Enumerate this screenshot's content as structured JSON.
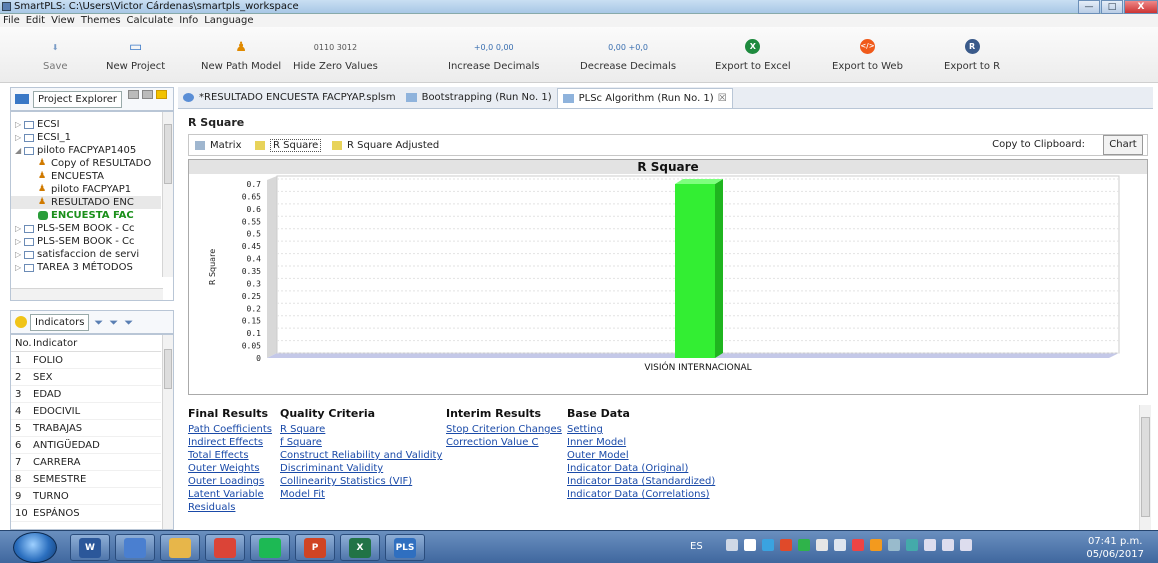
{
  "window": {
    "title": "SmartPLS: C:\\Users\\Victor Cárdenas\\smartpls_workspace",
    "minimize": "—",
    "maximize": "□",
    "close": "X"
  },
  "menu": [
    "File",
    "Edit",
    "View",
    "Themes",
    "Calculate",
    "Info",
    "Language"
  ],
  "toolbar": [
    {
      "label": "Save",
      "icon": "save-icon",
      "glyph": "⬇"
    },
    {
      "label": "New Project",
      "icon": "new-project-icon",
      "glyph": "▭"
    },
    {
      "label": "New Path Model",
      "icon": "new-path-model-icon",
      "glyph": "♟"
    },
    {
      "label": "Hide Zero Values",
      "icon": "hide-zero-values-icon",
      "glyph": "0110 3012"
    },
    {
      "label": "Increase Decimals",
      "icon": "increase-decimals-icon",
      "glyph": "+0,0 0,00"
    },
    {
      "label": "Decrease Decimals",
      "icon": "decrease-decimals-icon",
      "glyph": "0,00 +0,0"
    },
    {
      "label": "Export to Excel",
      "icon": "excel-icon",
      "glyph": "X"
    },
    {
      "label": "Export to Web",
      "icon": "web-icon",
      "glyph": "</>"
    },
    {
      "label": "Export to R",
      "icon": "r-icon",
      "glyph": "R"
    }
  ],
  "project_explorer": {
    "title": "Project Explorer",
    "items": [
      {
        "label": "ECSI",
        "type": "folder",
        "indent": 0,
        "toggle": "▷"
      },
      {
        "label": "ECSI_1",
        "type": "folder",
        "indent": 0,
        "toggle": "▷"
      },
      {
        "label": "piloto FACPYAP1405",
        "type": "folder",
        "indent": 0,
        "toggle": "◢"
      },
      {
        "label": "Copy of RESULTADO",
        "type": "model",
        "indent": 1,
        "toggle": ""
      },
      {
        "label": "ENCUESTA",
        "type": "model",
        "indent": 1,
        "toggle": ""
      },
      {
        "label": "piloto FACPYAP1",
        "type": "model",
        "indent": 1,
        "toggle": ""
      },
      {
        "label": "RESULTADO ENC",
        "type": "model",
        "indent": 1,
        "toggle": "",
        "selected": true
      },
      {
        "label": "ENCUESTA FAC",
        "type": "data",
        "indent": 1,
        "toggle": "",
        "green": true
      },
      {
        "label": "PLS-SEM BOOK - Cc",
        "type": "folder",
        "indent": 0,
        "toggle": "▷"
      },
      {
        "label": "PLS-SEM BOOK - Cc",
        "type": "folder",
        "indent": 0,
        "toggle": "▷"
      },
      {
        "label": "satisfaccion de servi",
        "type": "folder",
        "indent": 0,
        "toggle": "▷"
      },
      {
        "label": "TAREA 3 MÉTODOS",
        "type": "folder",
        "indent": 0,
        "toggle": "▷"
      }
    ]
  },
  "indicators": {
    "title": "Indicators",
    "headers": [
      "No.",
      "Indicator"
    ],
    "rows": [
      [
        "1",
        "FOLIO"
      ],
      [
        "2",
        "SEX"
      ],
      [
        "3",
        "EDAD"
      ],
      [
        "4",
        "EDOCIVIL"
      ],
      [
        "5",
        "TRABAJAS"
      ],
      [
        "6",
        "ANTIGÜEDAD"
      ],
      [
        "7",
        "CARRERA"
      ],
      [
        "8",
        "SEMESTRE"
      ],
      [
        "9",
        "TURNO"
      ],
      [
        "10",
        "ESPÁNOS"
      ]
    ]
  },
  "editor_tabs": [
    {
      "label": "*RESULTADO ENCUESTA FACPYAP.splsm",
      "active": false
    },
    {
      "label": "Bootstrapping (Run No. 1)",
      "active": false
    },
    {
      "label": "PLSc Algorithm (Run No. 1)",
      "active": true,
      "close": "☒"
    }
  ],
  "section_title": "R Square",
  "sub_tabs": [
    "Matrix",
    "R Square",
    "R Square Adjusted"
  ],
  "copy_to_clipboard": "Copy to Clipboard:",
  "chart_button": "Chart",
  "chart_data": {
    "type": "bar",
    "title": "R Square",
    "ylabel": "R Square",
    "xlabel": "",
    "categories": [
      "VISIÓN INTERNACIONAL"
    ],
    "values": [
      0.7
    ],
    "ylim": [
      0,
      0.7
    ],
    "yticks": [
      "0",
      "0.05",
      "0.1",
      "0.15",
      "0.2",
      "0.25",
      "0.3",
      "0.35",
      "0.4",
      "0.45",
      "0.5",
      "0.55",
      "0.6",
      "0.65",
      "0.7"
    ],
    "grid": true,
    "bar_color": "#33ee33"
  },
  "results": {
    "final": {
      "title": "Final Results",
      "links": [
        "Path Coefficients",
        "Indirect Effects",
        "Total Effects",
        "Outer Weights",
        "Outer Loadings",
        "Latent Variable",
        "Residuals"
      ]
    },
    "quality": {
      "title": "Quality Criteria",
      "links": [
        "R Square",
        "f Square",
        "Construct Reliability and Validity",
        "Discriminant Validity",
        "Collinearity Statistics (VIF)",
        "Model Fit"
      ]
    },
    "interim": {
      "title": "Interim Results",
      "links": [
        "Stop Criterion Changes",
        "Correction Value C"
      ]
    },
    "base": {
      "title": "Base Data",
      "links": [
        "Setting",
        "Inner Model",
        "Outer Model",
        "Indicator Data (Original)",
        "Indicator Data (Standardized)",
        "Indicator Data (Correlations)"
      ]
    }
  },
  "taskbar": {
    "apps": [
      {
        "name": "word-app",
        "glyph": "W",
        "color": "#2b579a"
      },
      {
        "name": "app-2",
        "glyph": "",
        "color": "#4a7fd0"
      },
      {
        "name": "explorer-app",
        "glyph": "",
        "color": "#e7b64a"
      },
      {
        "name": "chrome-app",
        "glyph": "",
        "color": "#db4437"
      },
      {
        "name": "spotify-app",
        "glyph": "",
        "color": "#1db954"
      },
      {
        "name": "powerpoint-app",
        "glyph": "P",
        "color": "#d04423"
      },
      {
        "name": "excel-app",
        "glyph": "X",
        "color": "#217346"
      },
      {
        "name": "smartpls-app",
        "glyph": "PLS",
        "color": "#2f6fc0"
      }
    ],
    "lang": "ES",
    "time": "07:41 p.m.",
    "date": "05/06/2017"
  }
}
